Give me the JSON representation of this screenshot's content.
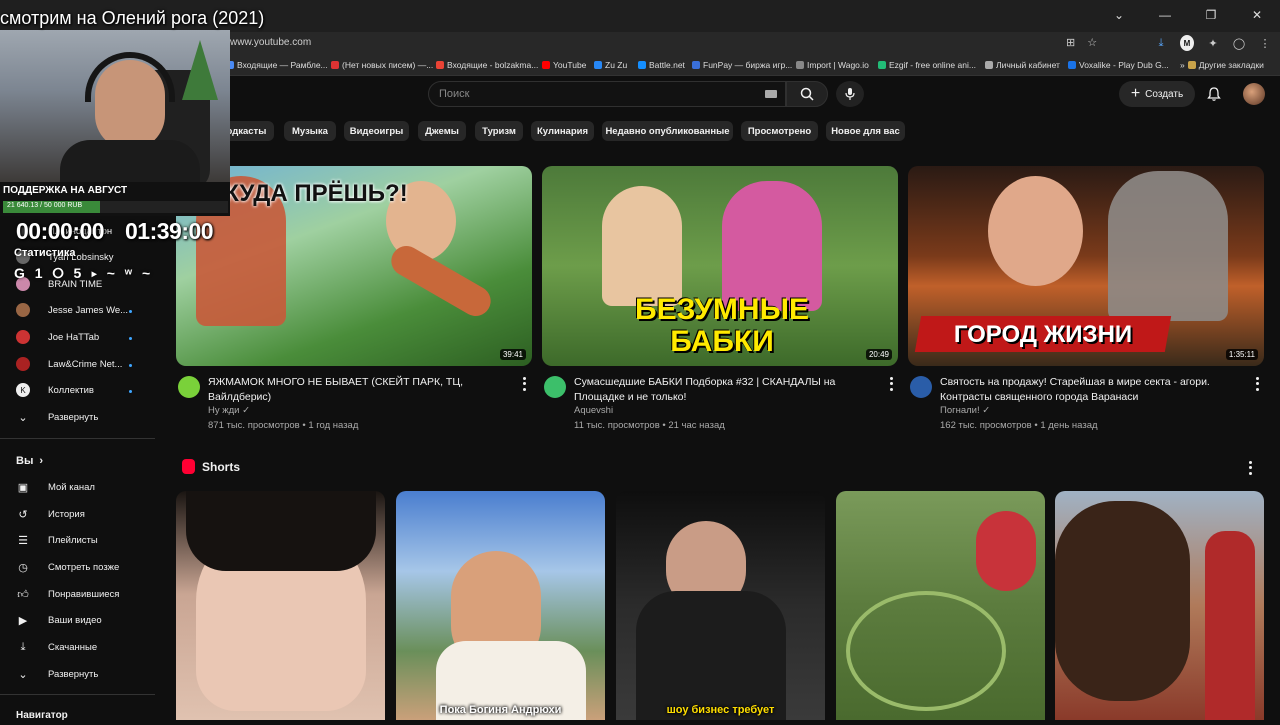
{
  "overlay": {
    "title": "смотрим на Олений рога (2021)",
    "donation_title": "ПОДДЕРЖКА НА АВГУСТ",
    "donation_text": "21 640.13 / 50 000 RUB",
    "donation_progress": 0.433,
    "timer_left": "00:00:00",
    "timer_right": "01:39:00",
    "stats_label": "Статистика",
    "stats_row": "G 1 ⭘ 5 ‣ ~ ʷ ~"
  },
  "browser": {
    "url": "www.youtube.com",
    "bookmarks": [
      "Входящие — Рамбле...",
      "(Нет новых писем) —...",
      "Входящие - bolzakma...",
      "YouTube",
      "Zu Zu",
      "Battle.net",
      "FunPay — биржа игр...",
      "Import | Wago.io",
      "Ezgif - free online ani...",
      "Личный кабинет",
      "Voxalike - Play Dub G..."
    ],
    "other_bookmarks": "Другие закладки",
    "bookmark_colors": [
      "#4a8af4",
      "#d33",
      "#ea4335",
      "#ff0000",
      "#2787f5",
      "#148eff",
      "#3a6fd8",
      "#888",
      "#2b7",
      "#aaa",
      "#1a73e8"
    ]
  },
  "header": {
    "search_placeholder": "Поиск",
    "create_label": "Создать"
  },
  "chips": [
    "Подкасты",
    "Музыка",
    "Видеоигры",
    "Джемы",
    "Туризм",
    "Кулинария",
    "Недавно опубликованные",
    "Просмотрено",
    "Новое для вас"
  ],
  "videos": [
    {
      "title": "ЯЖМАМОК МНОГО НЕ БЫВАЕТ (СКЕЙТ ПАРК, ТЦ, Вайлдберис)",
      "channel": "Ну жди",
      "meta": "871 тыс. просмотров • 1 год назад",
      "duration": "39:41",
      "caption": "КУДА ПРЁШЬ?!",
      "avatar_color": "#7ad13a"
    },
    {
      "title": "Сумасшедшие БАБКИ Подборка #32 | СКАНДАЛЫ на Площадке и не только!",
      "channel": "Aquevshi",
      "meta": "11 тыс. просмотров • 21 час назад",
      "duration": "20:49",
      "caption": "БЕЗУМНЫЕ БАБКИ",
      "avatar_color": "#3cbf6a"
    },
    {
      "title": "Святость на продажу! Старейшая в мире секта - агори. Контрасты священного города Варанаси",
      "channel": "Погнали!",
      "meta": "162 тыс. просмотров • 1 день назад",
      "duration": "1:35:11",
      "caption": "ГОРОД ЖИЗНИ",
      "avatar_color": "#2a5da8"
    }
  ],
  "shorts": {
    "title": "Shorts",
    "items": [
      {
        "caption": ""
      },
      {
        "caption": "Пока Богиня Андрюхи"
      },
      {
        "caption": "шоу бизнес требует"
      },
      {
        "caption": ""
      },
      {
        "caption": ""
      }
    ]
  },
  "sidebar": {
    "subscriptions": [
      {
        "label": "Ильинодалтон",
        "color": "#444"
      },
      {
        "label": "Tyan Lobsinsky",
        "color": "#666"
      },
      {
        "label": "BRAIN TIME",
        "color": "#c8a"
      },
      {
        "label": "Jesse James We...",
        "color": "#964"
      },
      {
        "label": "Joe HaTTab",
        "color": "#c33"
      },
      {
        "label": "Law&Crime Net...",
        "color": "#a22"
      },
      {
        "label": "Коллектив",
        "color": "#eee"
      },
      {
        "label": "Развернуть",
        "color": ""
      }
    ],
    "you_header": "Вы",
    "you_items": [
      "Мой канал",
      "История",
      "Плейлисты",
      "Смотреть позже",
      "Понравившиеся",
      "Ваши видео",
      "Скачанные",
      "Развернуть"
    ],
    "navigator_header": "Навигатор"
  }
}
